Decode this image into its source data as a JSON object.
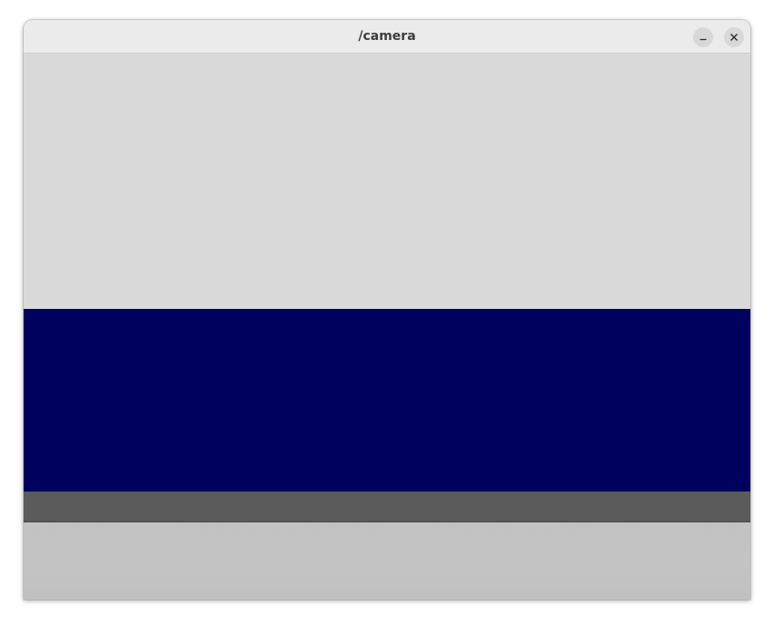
{
  "window": {
    "title": "/camera",
    "buttons": {
      "minimize_icon": "minimize-icon",
      "close_icon": "close-icon"
    }
  },
  "scene": {
    "colors": {
      "background": "#d9d9d9",
      "wall": "#00005f",
      "base": "#5b5b5b",
      "floor": "#c2c2c2"
    }
  }
}
